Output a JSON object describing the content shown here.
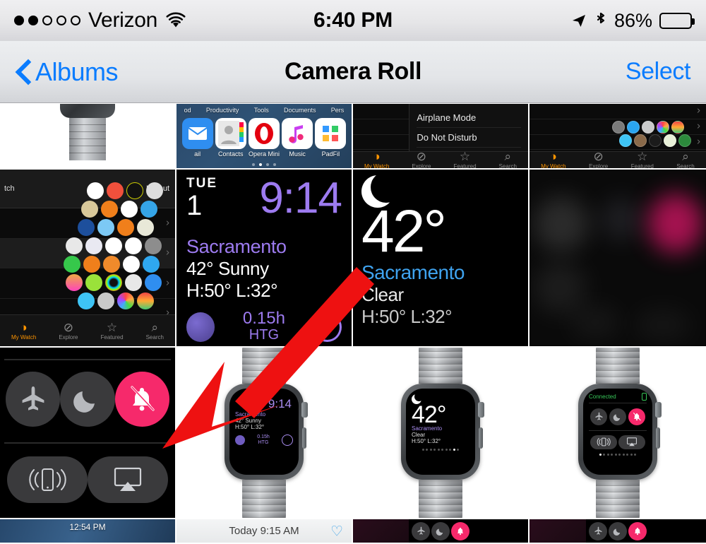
{
  "status_bar": {
    "signal_dots_total": 5,
    "signal_dots_filled": 2,
    "carrier": "Verizon",
    "wifi_icon": "wifi-icon",
    "time": "6:40 PM",
    "location_icon": "location-arrow-icon",
    "bluetooth_icon": "bluetooth-icon",
    "battery_percent": "86%",
    "battery_level": 86
  },
  "nav_bar": {
    "back_label": "Albums",
    "back_icon": "chevron-left-icon",
    "title": "Camera Roll",
    "select_label": "Select"
  },
  "colors": {
    "ios_blue": "#0a7cff",
    "accent_pink": "#f6296b",
    "watch_purple": "#9d7bf0",
    "weather_blue": "#3fa3ef",
    "connected_green": "#37c759",
    "arrow_red": "#ee1111"
  },
  "annotation": {
    "arrow_icon": "red-arrow-annotation",
    "color": "#ee1111",
    "points_from": [
      492,
      388
    ],
    "points_to": [
      233,
      632
    ]
  },
  "grid": {
    "rows": [
      {
        "row_label": "row-1-partial",
        "cells": [
          {
            "name": "photo-watch-white",
            "type": "product-photo-crop"
          },
          {
            "name": "photo-ios-home-screen",
            "type": "ios-home-screen",
            "folder_labels": [
              "od",
              "Productivity",
              "Tools",
              "Documents",
              "Pers"
            ],
            "apps": [
              {
                "label": "ail",
                "icon": "mail-icon"
              },
              {
                "label": "Contacts",
                "icon": "contacts-icon"
              },
              {
                "label": "Opera Mini",
                "icon": "opera-mini-icon"
              },
              {
                "label": "Music",
                "icon": "music-icon"
              },
              {
                "label": "PadFil",
                "icon": "padfile-icon"
              }
            ],
            "page_dots": 4,
            "page_active": 2
          },
          {
            "name": "photo-watch-app-settings",
            "type": "watch-app",
            "sheet_items": [
              "Airplane Mode",
              "Do Not Disturb"
            ],
            "tabs": [
              "My Watch",
              "Explore",
              "Featured",
              "Search"
            ]
          },
          {
            "name": "photo-watch-app-applayout",
            "type": "watch-app-honeycomb",
            "tabs": [
              "My Watch",
              "Explore",
              "Featured",
              "Search"
            ]
          }
        ]
      },
      {
        "row_label": "row-2",
        "cells": [
          {
            "name": "photo-watch-app-layout",
            "type": "watch-app-layout",
            "nav_left": "tch",
            "nav_right": "Layout",
            "tabs": [
              "My Watch",
              "Explore",
              "Featured",
              "Search"
            ]
          },
          {
            "name": "photo-modular-watch-face",
            "type": "watch-face-modular",
            "weekday": "TUE",
            "date": "1",
            "time": "9:14",
            "city": "Sacramento",
            "condition": "42° Sunny",
            "high_low": "H:50° L:32°",
            "complication_value": "0.15h",
            "complication_label": "HTG",
            "moon_icon": "moon-phase-icon"
          },
          {
            "name": "photo-weather-glance",
            "type": "watch-weather-glance",
            "moon_icon": "crescent-moon-icon",
            "temperature": "42°",
            "city": "Sacramento",
            "condition": "Clear",
            "high_low": "H:50° L:32°"
          },
          {
            "name": "photo-blurred-control-center",
            "type": "blurred-dark"
          }
        ]
      },
      {
        "row_label": "row-3",
        "cells": [
          {
            "name": "photo-watch-control-center",
            "type": "watch-control-center",
            "buttons": [
              {
                "name": "airplane-mode-icon",
                "active": false
              },
              {
                "name": "do-not-disturb-moon-icon",
                "active": false
              },
              {
                "name": "silent-mode-bell-icon",
                "active": true
              }
            ],
            "pills": [
              {
                "name": "ping-iphone-icon"
              },
              {
                "name": "airplay-icon"
              }
            ]
          },
          {
            "name": "photo-watch-product-modular",
            "type": "watch-product",
            "screen": "modular",
            "time": "9:14",
            "city": "Sacramento",
            "condition": "42° Sunny",
            "high_low": "H:50° L:32°",
            "complication_value": "0.15h",
            "complication_label": "HTG"
          },
          {
            "name": "photo-watch-product-weather",
            "type": "watch-product",
            "screen": "weather",
            "temperature": "42°",
            "city": "Sacramento",
            "condition": "Clear",
            "high_low": "H:50° L:32°",
            "page_dots": 10,
            "page_active": 8
          },
          {
            "name": "photo-watch-product-control-center",
            "type": "watch-product",
            "screen": "control-center",
            "status": "Connected",
            "battery_icon": "battery-icon",
            "buttons": [
              {
                "name": "airplane-mode-icon",
                "active": false
              },
              {
                "name": "do-not-disturb-moon-icon",
                "active": false
              },
              {
                "name": "silent-mode-bell-icon",
                "active": true
              }
            ],
            "pills": [
              {
                "name": "ping-iphone-icon"
              },
              {
                "name": "airplay-icon"
              }
            ],
            "page_dots": 10,
            "page_active": 0
          }
        ]
      },
      {
        "row_label": "row-4-partial",
        "cells": [
          {
            "name": "photo-lock-screen",
            "type": "lock-screen",
            "time": "12:54 PM"
          },
          {
            "name": "photo-today-bar",
            "type": "today-bar",
            "label": "Today  9:15 AM",
            "heart_icon": "heart-outline-icon"
          },
          {
            "name": "photo-control-center-strip-a",
            "type": "control-center-strip"
          },
          {
            "name": "photo-control-center-strip-b",
            "type": "control-center-strip"
          }
        ]
      }
    ]
  }
}
